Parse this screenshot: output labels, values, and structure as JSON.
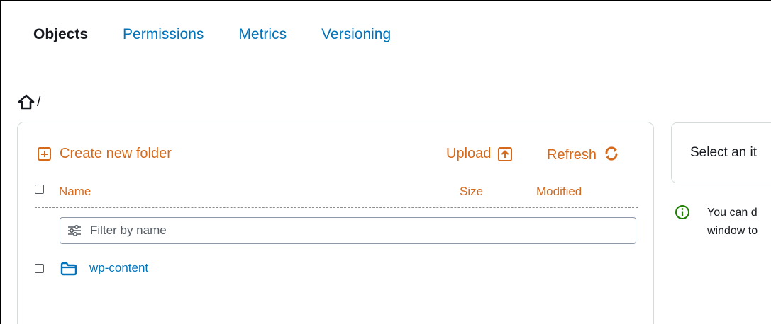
{
  "tabs": [
    {
      "label": "Objects",
      "active": true
    },
    {
      "label": "Permissions",
      "active": false
    },
    {
      "label": "Metrics",
      "active": false
    },
    {
      "label": "Versioning",
      "active": false
    }
  ],
  "breadcrumb": {
    "separator": "/",
    "icon": "home-icon"
  },
  "toolbar": {
    "create_folder_label": "Create new folder",
    "upload_label": "Upload",
    "refresh_label": "Refresh"
  },
  "table": {
    "columns": {
      "name": "Name",
      "size": "Size",
      "modified": "Modified"
    },
    "filter_placeholder": "Filter by name",
    "rows": [
      {
        "name": "wp-content",
        "icon": "folder-icon"
      }
    ]
  },
  "side_panel": {
    "title": "Select an it",
    "info_lines": [
      "You can d",
      "window to"
    ]
  },
  "colors": {
    "accent": "#d5691c",
    "link": "#0073bb",
    "info": "#1d8102",
    "text": "#16191f"
  }
}
